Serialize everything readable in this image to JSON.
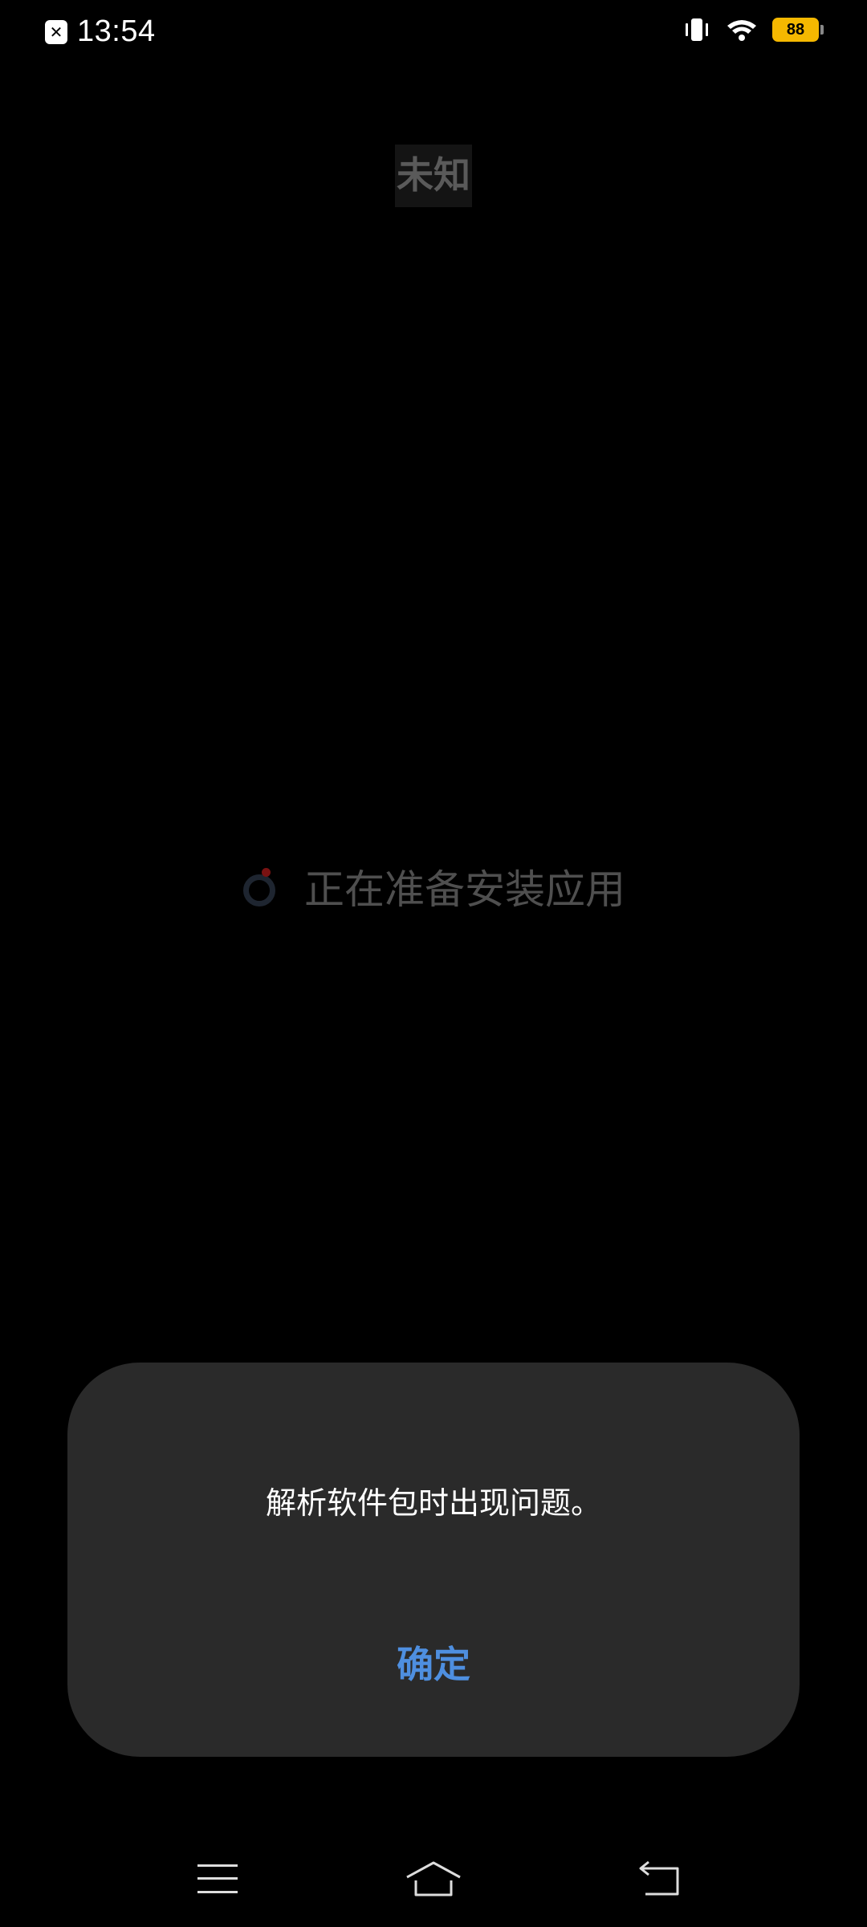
{
  "status_bar": {
    "time": "13:54",
    "battery_level": "88",
    "icons": [
      "notification-x-icon",
      "vibrate-icon",
      "wifi-icon",
      "battery-icon"
    ]
  },
  "screen": {
    "app_title": "未知",
    "progress_text": "正在准备安装应用"
  },
  "dialog": {
    "message": "解析软件包时出现问题。",
    "ok_label": "确定"
  },
  "nav_bar": {
    "icons": [
      "menu-icon",
      "home-icon",
      "back-icon"
    ]
  },
  "colors": {
    "background": "#000000",
    "dialog_bg": "#2a2a2a",
    "accent": "#4e8fe0",
    "battery": "#f5b800"
  }
}
